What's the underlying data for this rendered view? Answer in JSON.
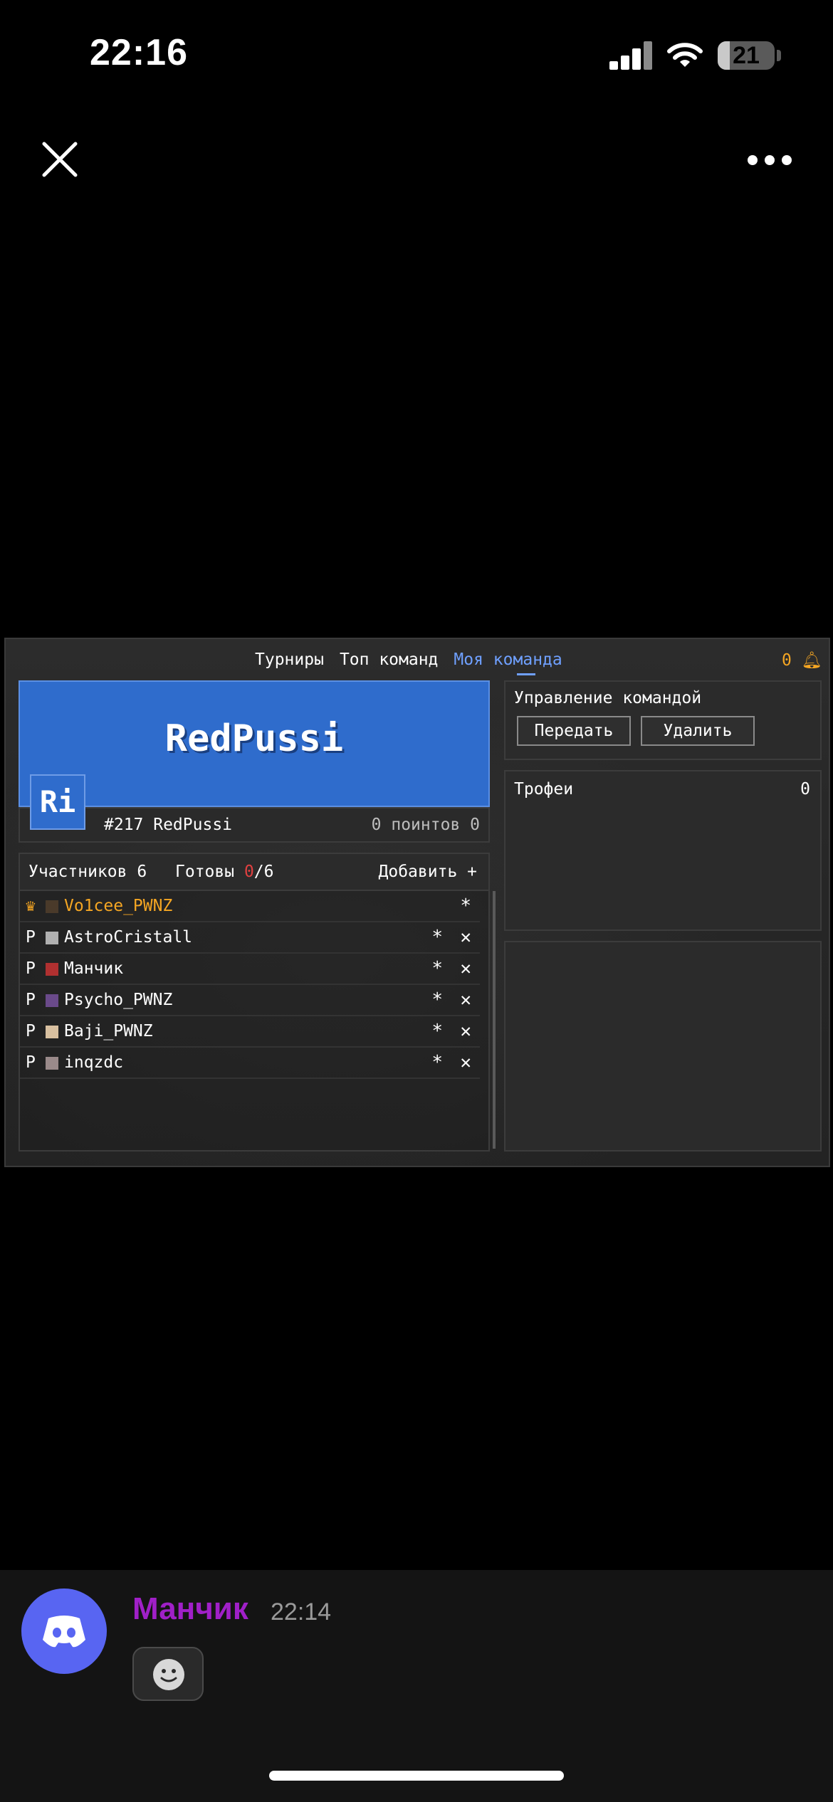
{
  "status_bar": {
    "time": "22:16",
    "battery_level": "21",
    "battery_fraction": 0.21,
    "signal_icon": "cellular-signal-icon",
    "wifi_icon": "wifi-icon"
  },
  "viewer": {
    "close_icon": "close-icon",
    "more_icon": "more-options-icon"
  },
  "game": {
    "nav_tabs": [
      {
        "label": "Турниры",
        "active": false
      },
      {
        "label": "Топ команд",
        "active": false
      },
      {
        "label": "Моя команда",
        "active": true
      }
    ],
    "notifications": {
      "count": "0",
      "icon": "bell-icon"
    },
    "team": {
      "name": "RedPussi",
      "logo_text": "Ri",
      "rank_line": "#217 RedPussi",
      "points": "0 поинтов 0"
    },
    "members": {
      "count_label": "Участников 6",
      "ready_prefix": "Готовы ",
      "ready_value": "0",
      "ready_total": "/6",
      "add_label": "Добавить +",
      "list": [
        {
          "prefix": "♛",
          "name": "Vo1cee_PWNZ",
          "leader": true,
          "avatar_color": "#4a3a2a"
        },
        {
          "prefix": "P",
          "name": "AstroCristall",
          "leader": false,
          "avatar_color": "#b0b0b0"
        },
        {
          "prefix": "P",
          "name": "Манчик",
          "leader": false,
          "avatar_color": "#b03030"
        },
        {
          "prefix": "P",
          "name": "Psycho_PWNZ",
          "leader": false,
          "avatar_color": "#6a4a8a"
        },
        {
          "prefix": "P",
          "name": "Baji_PWNZ",
          "leader": false,
          "avatar_color": "#d8c0a0"
        },
        {
          "prefix": "P",
          "name": "inqzdc",
          "leader": false,
          "avatar_color": "#9a8a8a"
        }
      ],
      "star_glyph": "*",
      "kick_glyph": "✕"
    },
    "manage": {
      "title": "Управление командой",
      "transfer_label": "Передать",
      "delete_label": "Удалить"
    },
    "trophies": {
      "title": "Трофеи",
      "count": "0"
    },
    "colors": {
      "accent_blue": "#2f6ccc",
      "active_tab": "#6fa0ff",
      "leader_gold": "#f5a623",
      "ready_red": "#e04040"
    }
  },
  "message": {
    "author": "Манчик",
    "time": "22:14",
    "author_color": "#a020c8",
    "avatar_icon": "discord-logo-icon",
    "reaction_icon": "smiley-face-icon"
  }
}
